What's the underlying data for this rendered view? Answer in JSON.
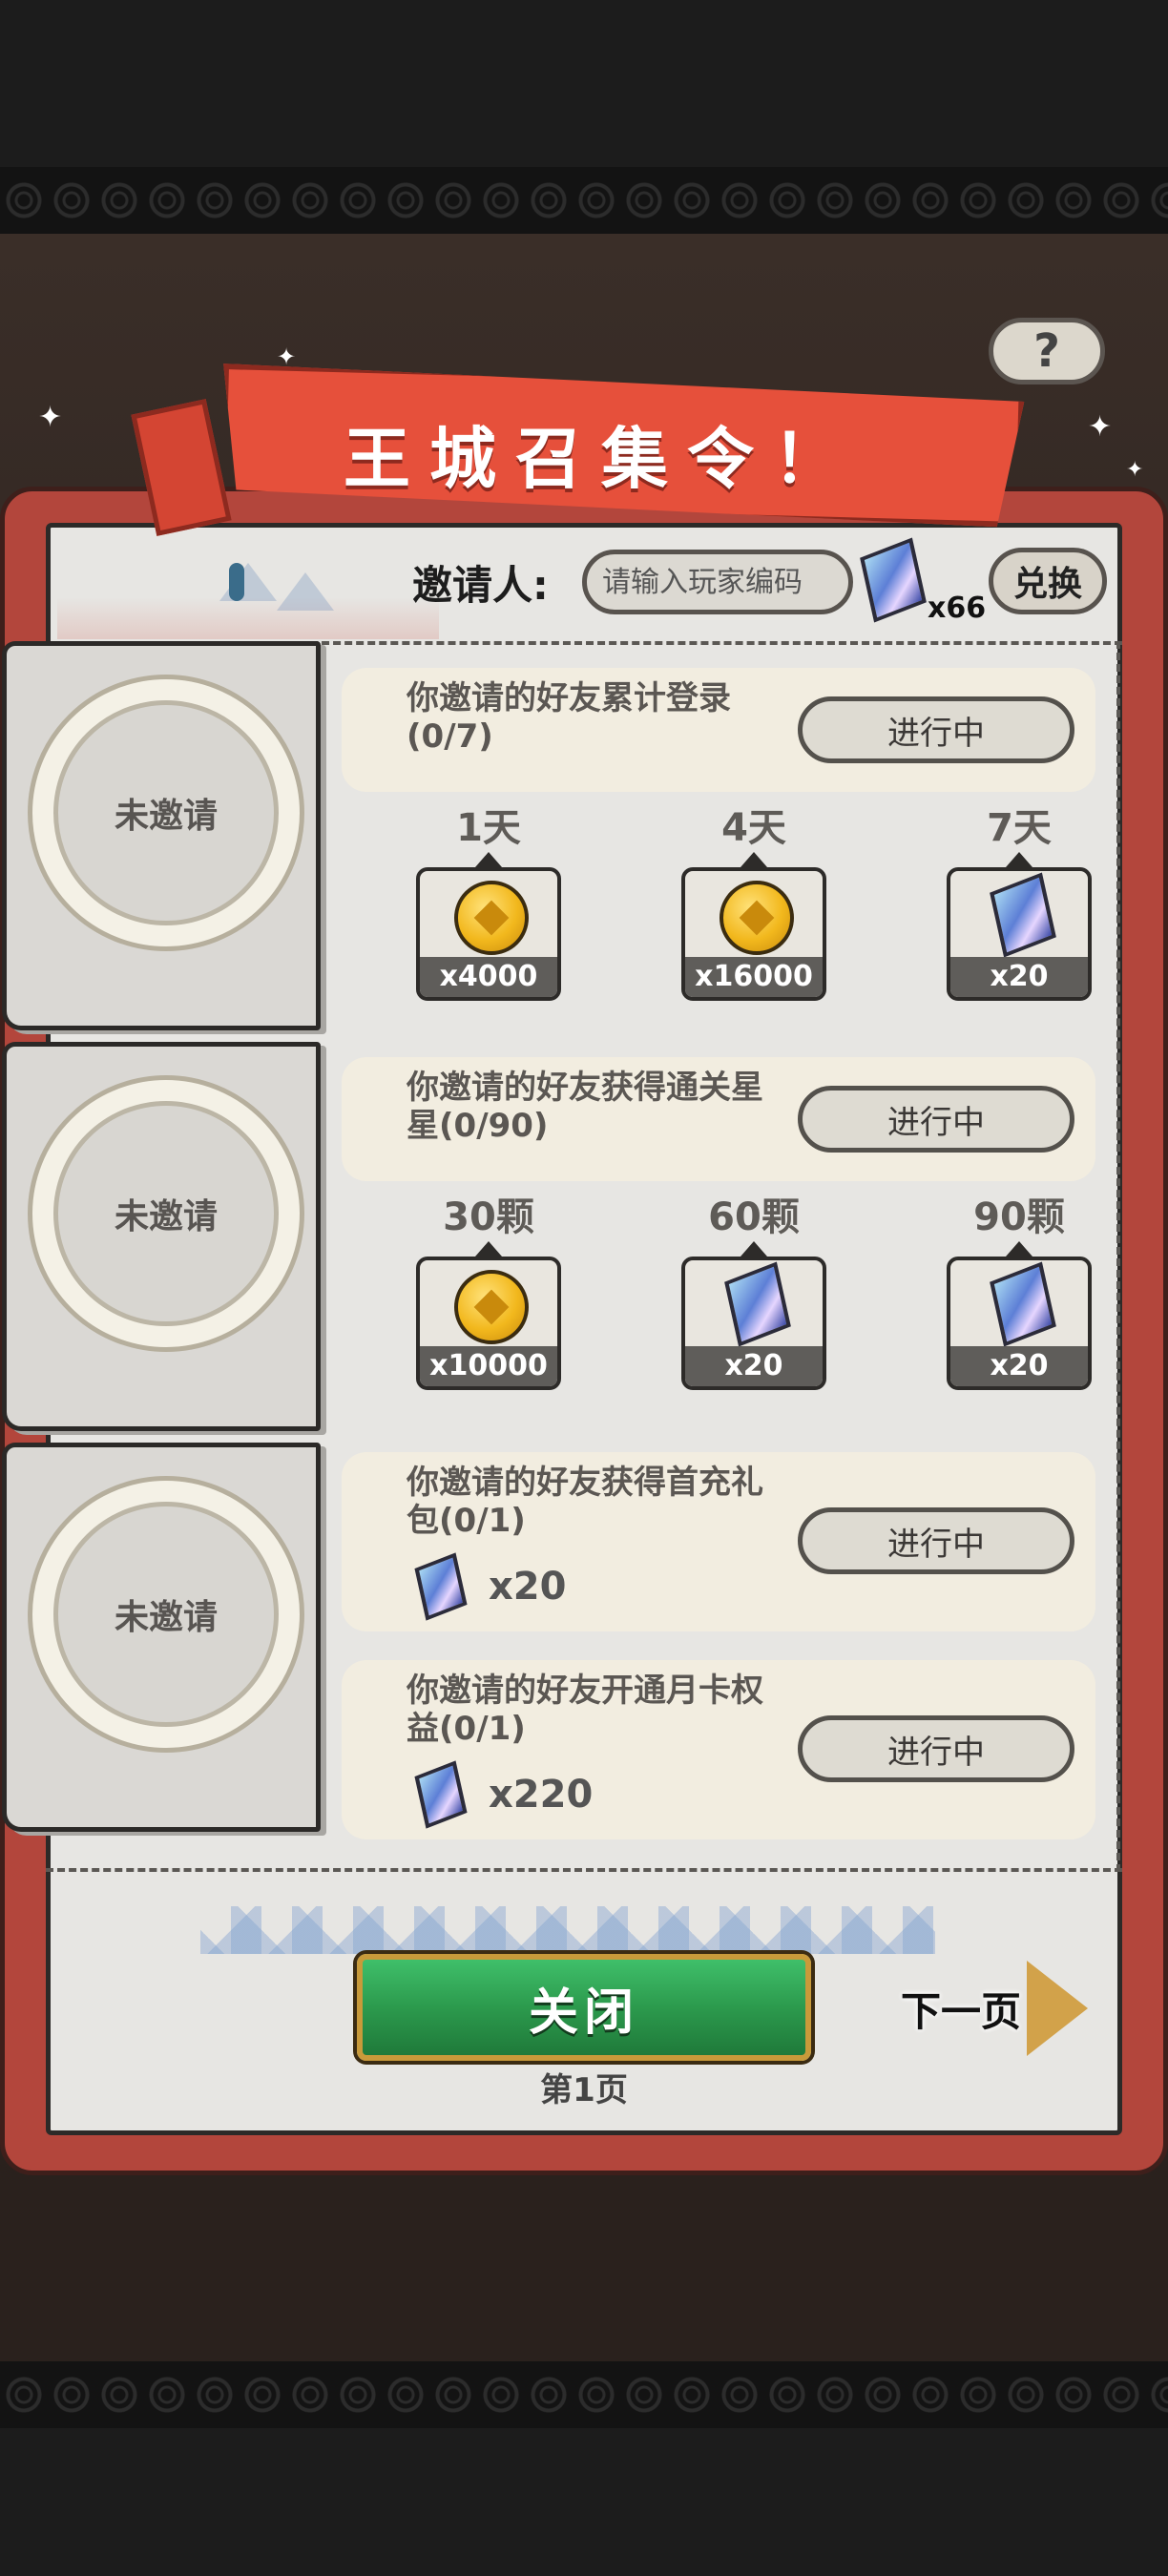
{
  "header": {
    "title": "王城召集令！",
    "help_icon": "?"
  },
  "inviter": {
    "label": "邀请人:",
    "placeholder": "请输入玩家编码",
    "currency_icon": "crystal-icon",
    "currency_count": "x66",
    "exchange_label": "兑换"
  },
  "slots": [
    {
      "status": "未邀请"
    },
    {
      "status": "未邀请"
    },
    {
      "status": "未邀请"
    }
  ],
  "tasks": [
    {
      "title": "你邀请的好友累计登录(0/7)",
      "status": "进行中",
      "tiers": [
        {
          "label": "1天",
          "icon": "coin-icon",
          "count": "x4000"
        },
        {
          "label": "4天",
          "icon": "coin-icon",
          "count": "x16000"
        },
        {
          "label": "7天",
          "icon": "crystal-icon",
          "count": "x20"
        }
      ]
    },
    {
      "title": "你邀请的好友获得通关星星(0/90)",
      "status": "进行中",
      "tiers": [
        {
          "label": "30颗",
          "icon": "coin-icon",
          "count": "x10000"
        },
        {
          "label": "60颗",
          "icon": "crystal-icon",
          "count": "x20"
        },
        {
          "label": "90颗",
          "icon": "crystal-icon",
          "count": "x20"
        }
      ]
    },
    {
      "title": "你邀请的好友获得首充礼包(0/1)",
      "status": "进行中",
      "reward": {
        "icon": "crystal-icon",
        "count": "x20"
      }
    },
    {
      "title": "你邀请的好友开通月卡权益(0/1)",
      "status": "进行中",
      "reward": {
        "icon": "crystal-icon",
        "count": "x220"
      }
    }
  ],
  "footer": {
    "close_label": "关闭",
    "page_label": "第1页",
    "next_label": "下一页"
  },
  "colors": {
    "banner_red": "#e6503b",
    "frame_red": "#b3463c",
    "close_green": "#2c9a4d",
    "paper": "#e7e6e3"
  }
}
